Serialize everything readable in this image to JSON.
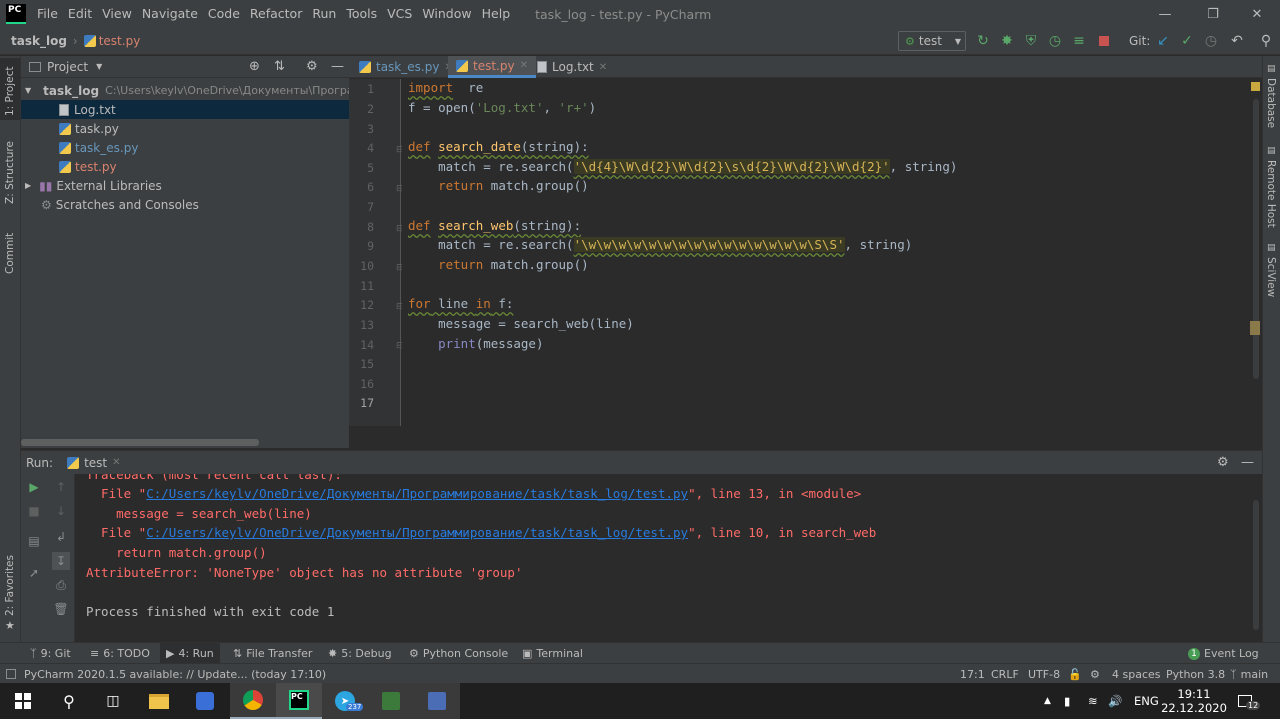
{
  "window": {
    "logo_text": "PC",
    "menu": [
      "File",
      "Edit",
      "View",
      "Navigate",
      "Code",
      "Refactor",
      "Run",
      "Tools",
      "VCS",
      "Window",
      "Help"
    ],
    "title": "task_log - test.py - PyCharm"
  },
  "navbar": {
    "project": "task_log",
    "file": "test.py",
    "run_config": "test",
    "git_label": "Git:"
  },
  "left_strip": {
    "project": "1: Project",
    "structure": "Z: Structure",
    "commit": "Commit",
    "favorites": "2: Favorites"
  },
  "right_strip": {
    "database": "Database",
    "remote_host": "Remote Host",
    "sciview": "SciView"
  },
  "project_panel": {
    "title": "Project",
    "root_name": "task_log",
    "root_path": "C:\\Users\\keylv\\OneDrive\\Документы\\Программ",
    "files": [
      "Log.txt",
      "task.py",
      "task_es.py",
      "test.py"
    ],
    "external": "External Libraries",
    "scratches": "Scratches and Consoles"
  },
  "editor": {
    "tabs": [
      "task_es.py",
      "test.py",
      "Log.txt"
    ],
    "line_numbers": [
      "1",
      "2",
      "3",
      "4",
      "5",
      "6",
      "7",
      "8",
      "9",
      "10",
      "11",
      "12",
      "13",
      "14",
      "15",
      "16",
      "17"
    ],
    "code": {
      "l1_kw": "import",
      "l1_rest": "  re",
      "l2": "f = open(",
      "l2_s1": "'Log.txt'",
      "l2_mid": ", ",
      "l2_s2": "'r+'",
      "l2_end": ")",
      "l4_kw": "def",
      "l4_fn": "search_date",
      "l4_rest": "(string):",
      "l5_a": "    match = re.search(",
      "l5_str": "'\\d{4}\\W\\d{2}\\W\\d{2}\\s\\d{2}\\W\\d{2}\\W\\d{2}'",
      "l5_b": ", string)",
      "l6_kw": "    return",
      "l6_rest": " match.group()",
      "l8_kw": "def",
      "l8_fn": "search_web",
      "l8_rest": "(string):",
      "l9_a": "    match = re.search(",
      "l9_str": "'\\w\\w\\w\\w\\w\\w\\w\\w\\w\\w\\w\\w\\w\\w\\w\\S\\S'",
      "l9_b": ", string)",
      "l10_kw": "    return",
      "l10_rest": " match.group()",
      "l12_kw1": "for",
      "l12_mid": " line ",
      "l12_kw2": "in",
      "l12_rest": " f:",
      "l13": "    message = search_web(line)",
      "l14_bi": "    print",
      "l14_rest": "(message)"
    }
  },
  "run_panel": {
    "label": "Run:",
    "tab": "test",
    "lines": {
      "l0": "Traceback (most recent call last):",
      "l1_a": "  File \"",
      "l1_link": "C:/Users/keylv/OneDrive/Документы/Программирование/task/task_log/test.py",
      "l1_b": "\", line 13, in <module>",
      "l2": "    message = search_web(line)",
      "l3_a": "  File \"",
      "l3_link": "C:/Users/keylv/OneDrive/Документы/Программирование/task/task_log/test.py",
      "l3_b": "\", line 10, in search_web",
      "l4": "    return match.group()",
      "l5": "AttributeError: 'NoneType' object has no attribute 'group'",
      "l7": "Process finished with exit code 1"
    }
  },
  "tool_tabs": {
    "git": "9: Git",
    "todo": "6: TODO",
    "run": "4: Run",
    "file_transfer": "File Transfer",
    "debug": "5: Debug",
    "python_console": "Python Console",
    "terminal": "Terminal",
    "event_log": "Event Log",
    "event_count": "1"
  },
  "status_bar": {
    "message": "PyCharm 2020.1.5 available: // Update... (today 17:10)",
    "position": "17:1",
    "line_sep": "CRLF",
    "encoding": "UTF-8",
    "indent": "4 spaces",
    "interpreter": "Python 3.8",
    "branch": "main"
  },
  "taskbar": {
    "lang": "ENG",
    "time": "19:11",
    "date": "22.12.2020",
    "notif_count": "12",
    "telegram_badge": "237"
  },
  "colors": {
    "accent_green": "#21d789",
    "error_red": "#ff6b68",
    "link_blue": "#287bde",
    "keyword": "#cc7832",
    "string": "#6a8759",
    "function": "#ffc66d"
  }
}
